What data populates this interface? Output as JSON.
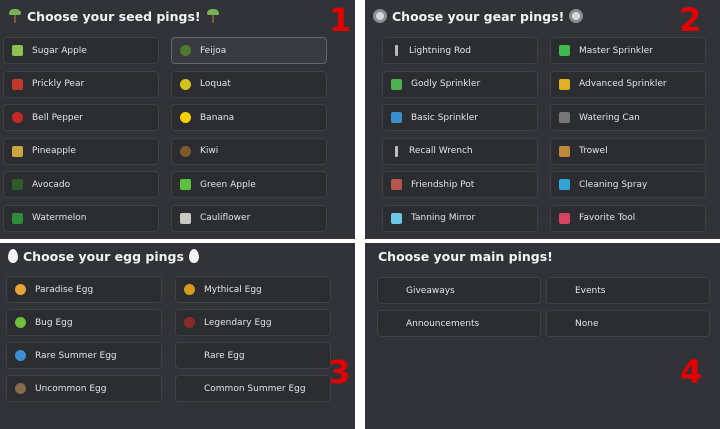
{
  "seed": {
    "title": "Choose your seed pings!",
    "number": "1",
    "items": [
      {
        "label": "Sugar Apple",
        "icon": "sugar-apple-icon",
        "color": "#8cc152"
      },
      {
        "label": "Feijoa",
        "icon": "feijoa-icon",
        "color": "#4f7a2e"
      },
      {
        "label": "Prickly Pear",
        "icon": "prickly-pear-icon",
        "color": "#c0392b"
      },
      {
        "label": "Loquat",
        "icon": "loquat-icon",
        "color": "#d4c21d"
      },
      {
        "label": "Bell Pepper",
        "icon": "bell-pepper-icon",
        "color": "#c62828"
      },
      {
        "label": "Banana",
        "icon": "banana-icon",
        "color": "#f5d000"
      },
      {
        "label": "Pineapple",
        "icon": "pineapple-icon",
        "color": "#c9a53b"
      },
      {
        "label": "Kiwi",
        "icon": "kiwi-icon",
        "color": "#7d5a2b"
      },
      {
        "label": "Avocado",
        "icon": "avocado-icon",
        "color": "#2f5d2a"
      },
      {
        "label": "Green Apple",
        "icon": "green-apple-icon",
        "color": "#5ec13d"
      },
      {
        "label": "Watermelon",
        "icon": "watermelon-icon",
        "color": "#2e8b3a"
      },
      {
        "label": "Cauliflower",
        "icon": "cauliflower-icon",
        "color": "#c8c8c0"
      }
    ]
  },
  "gear": {
    "title": "Choose your gear pings!",
    "number": "2",
    "items": [
      {
        "label": "Lightning Rod",
        "icon": "lightning-rod-icon",
        "color": "#b8b8b8"
      },
      {
        "label": "Master Sprinkler",
        "icon": "master-sprinkler-icon",
        "color": "#3dbb4c"
      },
      {
        "label": "Godly Sprinkler",
        "icon": "godly-sprinkler-icon",
        "color": "#4caf50"
      },
      {
        "label": "Advanced Sprinkler",
        "icon": "advanced-sprinkler-icon",
        "color": "#e0b020"
      },
      {
        "label": "Basic Sprinkler",
        "icon": "basic-sprinkler-icon",
        "color": "#3b8fd1"
      },
      {
        "label": "Watering Can",
        "icon": "watering-can-icon",
        "color": "#777777"
      },
      {
        "label": "Recall Wrench",
        "icon": "recall-wrench-icon",
        "color": "#bdbdbd"
      },
      {
        "label": "Trowel",
        "icon": "trowel-icon",
        "color": "#c08a3e"
      },
      {
        "label": "Friendship Pot",
        "icon": "friendship-pot-icon",
        "color": "#b5574f"
      },
      {
        "label": "Cleaning Spray",
        "icon": "cleaning-spray-icon",
        "color": "#2fa5d8"
      },
      {
        "label": "Tanning Mirror",
        "icon": "tanning-mirror-icon",
        "color": "#6ec6ea"
      },
      {
        "label": "Favorite Tool",
        "icon": "favorite-tool-icon",
        "color": "#d9415f"
      }
    ]
  },
  "egg": {
    "title": "Choose your egg pings",
    "number": "3",
    "items": [
      {
        "label": "Paradise Egg",
        "icon": "paradise-egg-icon",
        "color": "#e8a33a"
      },
      {
        "label": "Mythical Egg",
        "icon": "mythical-egg-icon",
        "color": "#d99a1e"
      },
      {
        "label": "Bug Egg",
        "icon": "bug-egg-icon",
        "color": "#6fbf3a"
      },
      {
        "label": "Legendary Egg",
        "icon": "legendary-egg-icon",
        "color": "#8a2b2b"
      },
      {
        "label": "Rare Summer Egg",
        "icon": "rare-summer-egg-icon",
        "color": "#3c8fd6"
      },
      {
        "label": "Rare Egg",
        "icon": "",
        "color": ""
      },
      {
        "label": "Uncommon Egg",
        "icon": "uncommon-egg-icon",
        "color": "#8b6a4a"
      },
      {
        "label": "Common Summer Egg",
        "icon": "",
        "color": ""
      }
    ]
  },
  "main": {
    "title": "Choose your main pings!",
    "number": "4",
    "items": [
      {
        "label": "Giveaways"
      },
      {
        "label": "Events"
      },
      {
        "label": "Announcements"
      },
      {
        "label": "None"
      }
    ]
  },
  "colors": {
    "panel": "#313338",
    "button": "#2b2d31",
    "button_border": "#3f4147",
    "number": "#e60000"
  }
}
